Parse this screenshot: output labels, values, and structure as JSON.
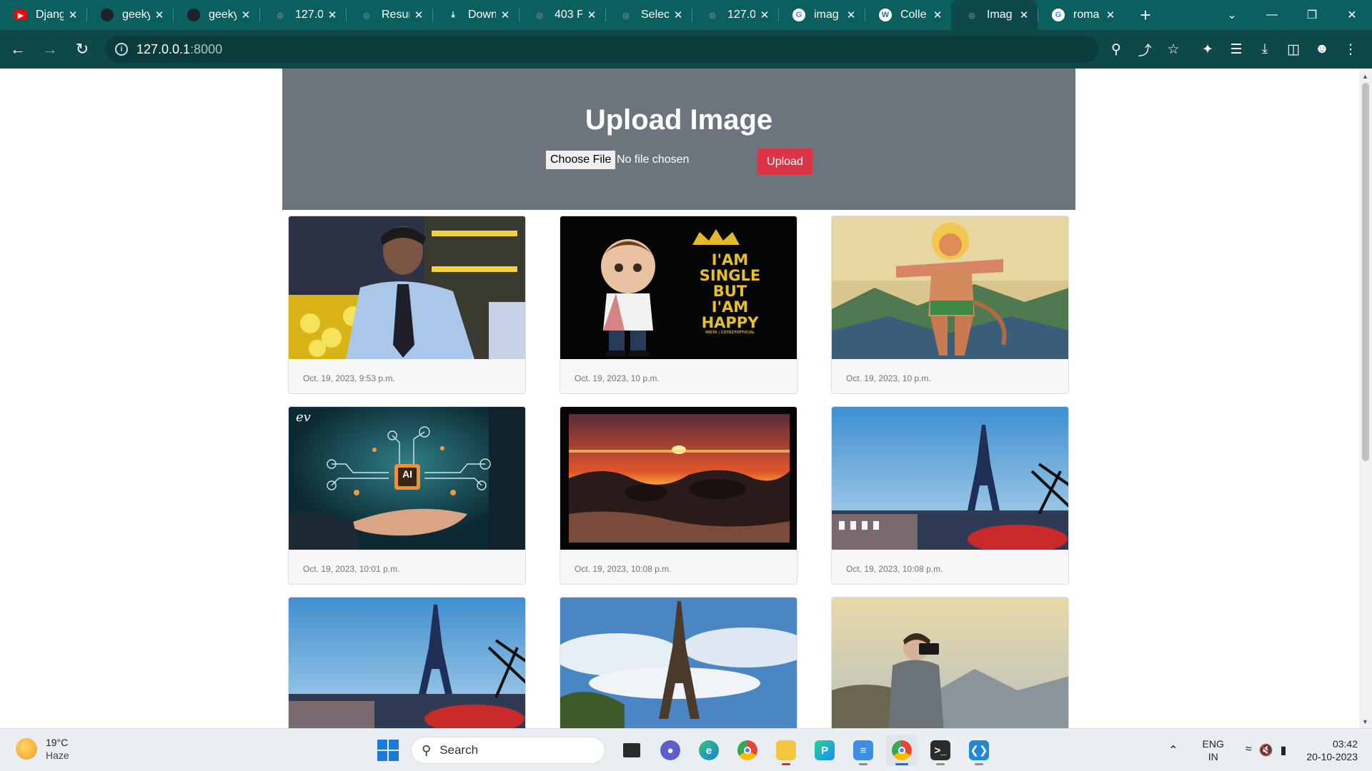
{
  "browser": {
    "tabs": [
      {
        "title": "Django",
        "favicon": "youtube-icon",
        "color": "#ff0000"
      },
      {
        "title": "geeky",
        "favicon": "github-icon",
        "color": "#1f2328"
      },
      {
        "title": "geeky",
        "favicon": "github-icon",
        "color": "#1f2328"
      },
      {
        "title": "127.0",
        "favicon": "globe-icon",
        "color": "#9aa0a6"
      },
      {
        "title": "Resur",
        "favicon": "globe-icon",
        "color": "#9aa0a6"
      },
      {
        "title": "Down",
        "favicon": "download-icon",
        "color": "#ffffff"
      },
      {
        "title": "403 F",
        "favicon": "globe-icon",
        "color": "#9aa0a6"
      },
      {
        "title": "Selec",
        "favicon": "globe-icon",
        "color": "#9aa0a6"
      },
      {
        "title": "127.0",
        "favicon": "globe-icon",
        "color": "#9aa0a6"
      },
      {
        "title": "imag",
        "favicon": "google-icon",
        "color": "#ffffff"
      },
      {
        "title": "Colle",
        "favicon": "wordpress-icon",
        "color": "#ffffff"
      },
      {
        "title": "Imag",
        "favicon": "globe-icon",
        "color": "#9aa0a6",
        "active": true
      },
      {
        "title": "roma",
        "favicon": "google-icon",
        "color": "#ffffff"
      }
    ],
    "url_host": "127.0.0.1",
    "url_port": ":8000"
  },
  "page": {
    "heading": "Upload Image",
    "file_button": "Choose File",
    "file_status": "No file chosen",
    "upload_button": "Upload",
    "accent_color": "#dc3545",
    "hero_color": "#6c757d"
  },
  "gallery": [
    {
      "date": "Oct. 19, 2023, 9:53 p.m.",
      "subject": "man-portrait"
    },
    {
      "date": "Oct. 19, 2023, 10 p.m.",
      "subject": "cartoon-boy",
      "overlay_text": [
        "I'AM",
        "SINGLE",
        "BUT",
        "I'AM",
        "HAPPY"
      ],
      "overlay_small": "INSTA | CUTEZYOFFICIAL"
    },
    {
      "date": "Oct. 19, 2023, 10 p.m.",
      "subject": "hanuman-painting"
    },
    {
      "date": "Oct. 19, 2023, 10:01 p.m.",
      "subject": "ai-circuit-hand",
      "chip_label": "AI",
      "signature": "ev"
    },
    {
      "date": "Oct. 19, 2023, 10:08 p.m.",
      "subject": "sunset-beach"
    },
    {
      "date": "Oct. 19, 2023, 10:08 p.m.",
      "subject": "eiffel-tower-dusk"
    },
    {
      "date": "",
      "subject": "eiffel-tower-dusk"
    },
    {
      "date": "",
      "subject": "eiffel-tower-clouds"
    },
    {
      "date": "",
      "subject": "photographer-mountains"
    }
  ],
  "taskbar": {
    "weather_temp": "19°C",
    "weather_condition": "Haze",
    "search_label": "Search",
    "language": "ENG",
    "region": "IN",
    "time": "03:42",
    "date": "20-10-2023"
  }
}
